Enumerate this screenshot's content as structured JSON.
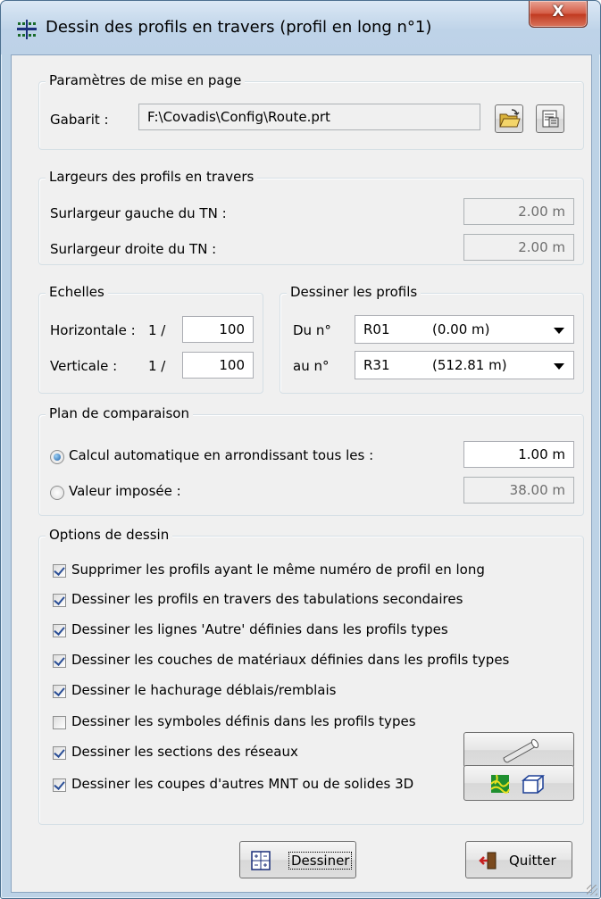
{
  "window": {
    "title": "Dessin des profils en travers (profil en long n°1)",
    "close_label": "X"
  },
  "layout_group": {
    "legend": "Paramètres de mise en page",
    "template_label": "Gabarit :",
    "template_value": "F:\\Covadis\\Config\\Route.prt",
    "browse_icon": "open-folder-icon",
    "properties_icon": "properties-icon"
  },
  "widths_group": {
    "legend": "Largeurs des profils en travers",
    "left_label": "Surlargeur gauche du TN :",
    "left_value": "2.00 m",
    "right_label": "Surlargeur droite du TN :",
    "right_value": "2.00 m"
  },
  "scales_group": {
    "legend": "Echelles",
    "horizontal_label": "Horizontale :",
    "vertical_label": "Verticale :",
    "ratio_prefix": "1 /",
    "horizontal_value": "100",
    "vertical_value": "100"
  },
  "profiles_group": {
    "legend": "Dessiner les profils",
    "from_label": "Du n°",
    "to_label": "au n°",
    "from_code": "R01",
    "from_distance": "(0.00 m)",
    "to_code": "R31",
    "to_distance": "(512.81 m)"
  },
  "comparison_group": {
    "legend": "Plan de comparaison",
    "auto_label": "Calcul automatique en arrondissant tous les :",
    "auto_value": "1.00 m",
    "auto_selected": true,
    "imposed_label": "Valeur imposée :",
    "imposed_value": "38.00 m"
  },
  "options_group": {
    "legend": "Options de dessin",
    "items": [
      {
        "label": "Supprimer les profils ayant le même numéro de profil en long",
        "checked": true
      },
      {
        "label": "Dessiner les profils en travers des tabulations secondaires",
        "checked": true
      },
      {
        "label": "Dessiner les lignes 'Autre' définies dans les profils types",
        "checked": true
      },
      {
        "label": "Dessiner les couches de matériaux définies dans les profils types",
        "checked": true
      },
      {
        "label": "Dessiner le hachurage déblais/remblais",
        "checked": true
      },
      {
        "label": "Dessiner les symboles définis dans les profils types",
        "checked": false
      },
      {
        "label": "Dessiner les sections des réseaux",
        "checked": true
      },
      {
        "label": "Dessiner les coupes d'autres MNT ou de solides 3D",
        "checked": true
      }
    ],
    "network_icon": "pipe-icon",
    "mnt_icon": "terrain-solid-icon"
  },
  "footer": {
    "draw_label": "Dessiner",
    "quit_label": "Quitter"
  },
  "colors": {
    "title_bar": "#bed3e8",
    "close_button": "#c0391f",
    "client_background": "#f0f0f0",
    "checkbox_mark": "#2a4e96"
  }
}
